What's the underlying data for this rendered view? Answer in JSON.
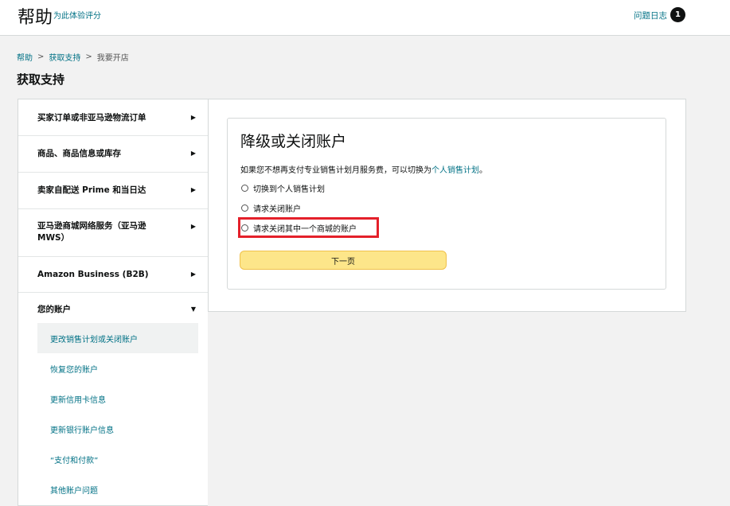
{
  "header": {
    "title": "帮助",
    "rate_link": "为此体验评分",
    "log_link": "问题日志",
    "log_count": "1"
  },
  "breadcrumb": {
    "items": [
      "帮助",
      "获取支持",
      "我要开店"
    ],
    "separator": ">"
  },
  "page_title": "获取支持",
  "sidebar": {
    "categories": [
      {
        "label": "买家订单或非亚马逊物流订单",
        "arrow": "▶"
      },
      {
        "label": "商品、商品信息或库存",
        "arrow": "▶"
      },
      {
        "label": "卖家自配送 Prime 和当日达",
        "arrow": "▶"
      },
      {
        "label": "亚马逊商城网络服务（亚马逊 MWS）",
        "arrow": "▶"
      },
      {
        "label": "Amazon Business (B2B)",
        "arrow": "▶"
      },
      {
        "label": "您的账户",
        "arrow": "▼"
      }
    ],
    "sub_items": [
      {
        "label": "更改销售计划或关闭账户",
        "active": true
      },
      {
        "label": "恢复您的账户"
      },
      {
        "label": "更新信用卡信息"
      },
      {
        "label": "更新银行账户信息"
      },
      {
        "label": "“支付和付款”"
      },
      {
        "label": "其他账户问题"
      }
    ]
  },
  "card": {
    "title": "降级或关闭账户",
    "desc_text": "如果您不想再支付专业销售计划月服务费，可以切换为",
    "desc_link": "个人销售计划",
    "desc_end": "。",
    "options": [
      "切换到个人销售计划",
      "请求关闭账户",
      "请求关闭其中一个商城的账户"
    ],
    "button_label": "下一页"
  },
  "colors": {
    "link": "#007185",
    "highlight": "#e4202a",
    "button_bg": "#fde68a"
  }
}
